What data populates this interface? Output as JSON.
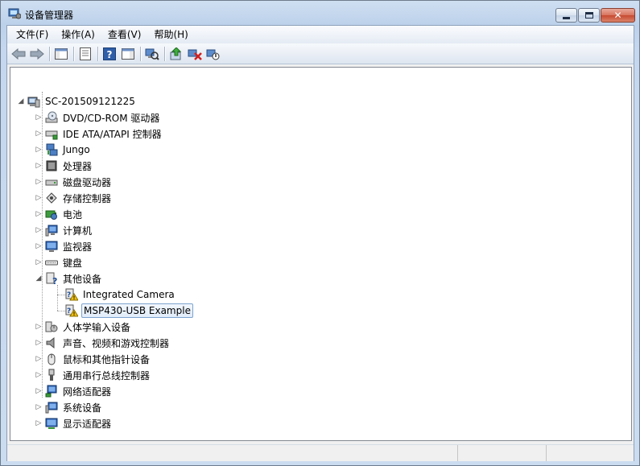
{
  "window": {
    "title": "设备管理器",
    "icon": "device-manager-icon",
    "caption_buttons": [
      "minimize-icon",
      "maximize-icon",
      "close-icon"
    ]
  },
  "menubar": {
    "items": [
      "文件(F)",
      "操作(A)",
      "查看(V)",
      "帮助(H)"
    ]
  },
  "toolbar": {
    "buttons": [
      "back-arrow-icon",
      "forward-arrow-icon",
      "show-hide-console-tree-icon",
      "properties-icon",
      "help-icon",
      "show-action-pane-icon",
      "scan-hardware-icon",
      "update-driver-icon",
      "uninstall-icon",
      "disable-icon"
    ]
  },
  "tree": {
    "root": {
      "label": "SC-201509121225",
      "icon": "computer-icon",
      "expanded": true
    },
    "items": [
      {
        "label": "DVD/CD-ROM 驱动器",
        "icon": "dvd-drive-icon",
        "expanded": false
      },
      {
        "label": "IDE ATA/ATAPI 控制器",
        "icon": "ide-controller-icon",
        "expanded": false
      },
      {
        "label": "Jungo",
        "icon": "network-device-icon",
        "expanded": false
      },
      {
        "label": "处理器",
        "icon": "processor-icon",
        "expanded": false
      },
      {
        "label": "磁盘驱动器",
        "icon": "disk-drive-icon",
        "expanded": false
      },
      {
        "label": "存储控制器",
        "icon": "storage-controller-icon",
        "expanded": false
      },
      {
        "label": "电池",
        "icon": "battery-icon",
        "expanded": false
      },
      {
        "label": "计算机",
        "icon": "computer-icon",
        "expanded": false
      },
      {
        "label": "监视器",
        "icon": "monitor-icon",
        "expanded": false
      },
      {
        "label": "键盘",
        "icon": "keyboard-icon",
        "expanded": false
      },
      {
        "label": "其他设备",
        "icon": "other-devices-icon",
        "expanded": true,
        "children": [
          {
            "label": "Integrated Camera",
            "icon": "unknown-device-warning-icon",
            "selected": false
          },
          {
            "label": "MSP430-USB Example",
            "icon": "unknown-device-warning-icon",
            "selected": true
          }
        ]
      },
      {
        "label": "人体学输入设备",
        "icon": "hid-icon",
        "expanded": false
      },
      {
        "label": "声音、视频和游戏控制器",
        "icon": "speaker-icon",
        "expanded": false
      },
      {
        "label": "鼠标和其他指针设备",
        "icon": "mouse-icon",
        "expanded": false
      },
      {
        "label": "通用串行总线控制器",
        "icon": "usb-icon",
        "expanded": false
      },
      {
        "label": "网络适配器",
        "icon": "network-adapter-icon",
        "expanded": false
      },
      {
        "label": "系统设备",
        "icon": "system-devices-icon",
        "expanded": false
      },
      {
        "label": "显示适配器",
        "icon": "display-adapter-icon",
        "expanded": false
      }
    ]
  },
  "colors": {
    "selection_border": "#7da2ce",
    "selection_fill": "#e0ecfa",
    "warning": "#f5c400",
    "close_button": "#c74a31"
  }
}
